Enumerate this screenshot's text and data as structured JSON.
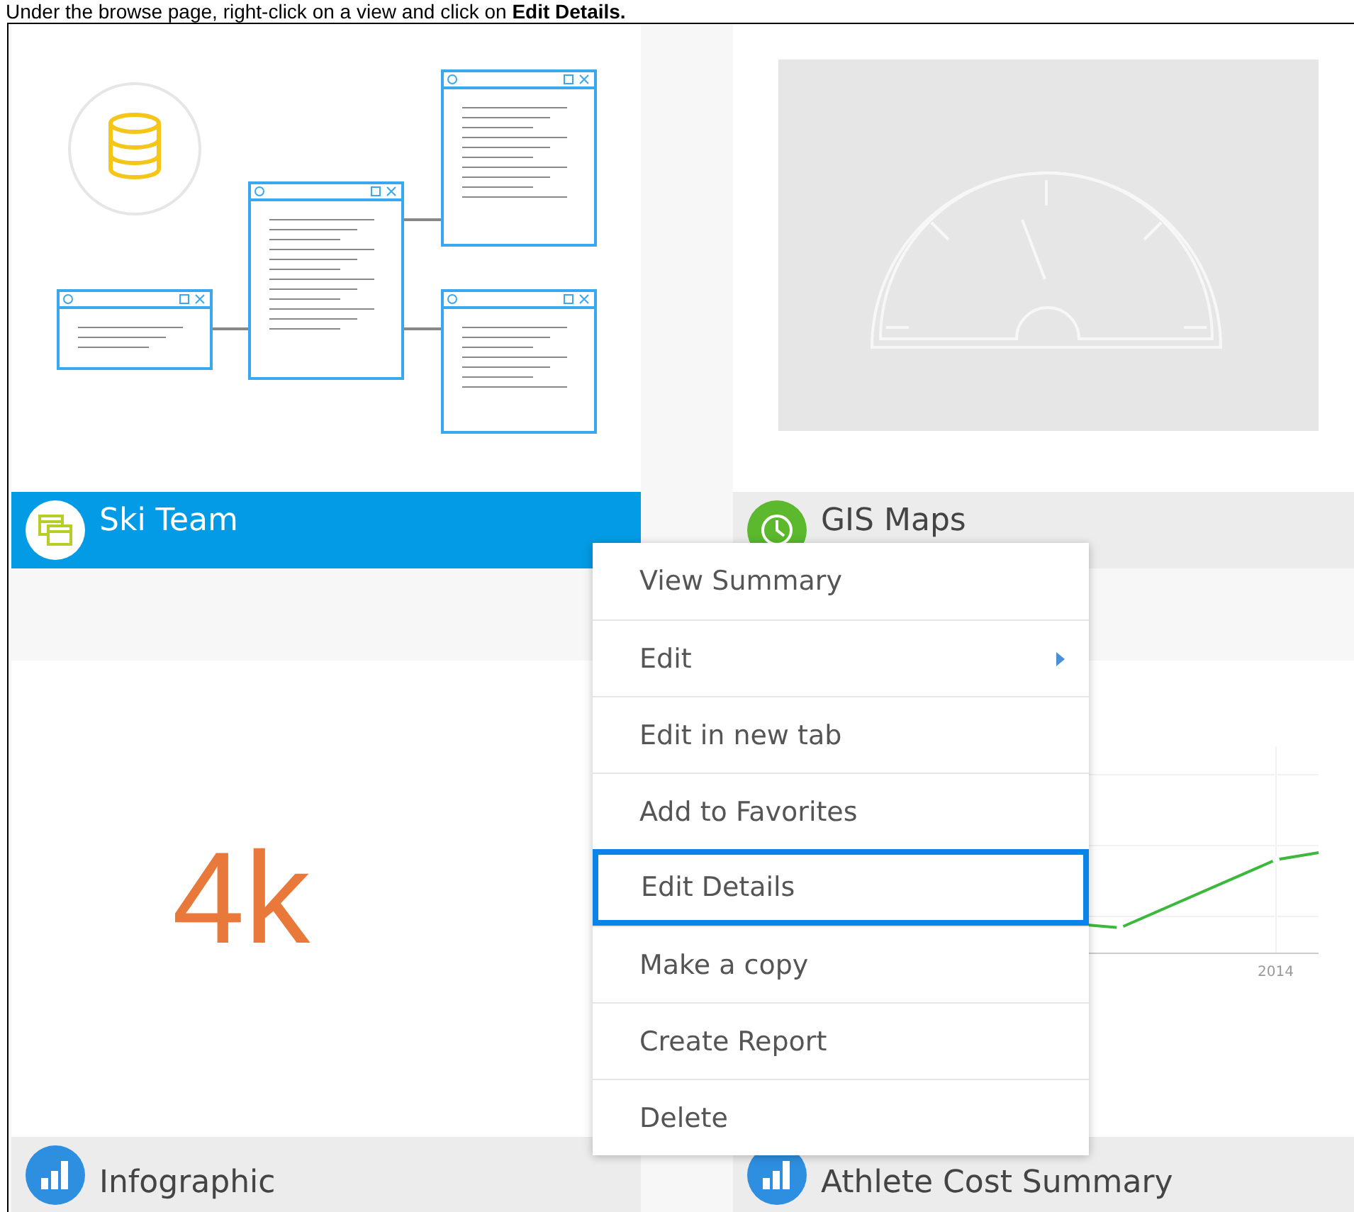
{
  "caption": "Under the browse page, right-click on a view and click on **Edit Details.**",
  "views": [
    {
      "title": "Ski Team",
      "kind": "diagram",
      "selected": true
    },
    {
      "title": "GIS Maps",
      "kind": "gauge",
      "selected": false
    },
    {
      "title": "Infographic",
      "kind": "metric",
      "value": "4k",
      "selected": false
    },
    {
      "title": "Athlete Cost Summary",
      "kind": "line",
      "axis_label": "2014",
      "selected": false
    }
  ],
  "context_menu": {
    "items": [
      {
        "label": "View Summary",
        "submenu": false,
        "selected": false
      },
      {
        "label": "Edit",
        "submenu": true,
        "selected": false
      },
      {
        "label": "Edit in new tab",
        "submenu": false,
        "selected": false
      },
      {
        "label": "Add to Favorites",
        "submenu": false,
        "selected": false
      },
      {
        "label": "Edit Details",
        "submenu": false,
        "selected": true
      },
      {
        "label": "Make a copy",
        "submenu": false,
        "selected": false
      },
      {
        "label": "Create Report",
        "submenu": false,
        "selected": false
      },
      {
        "label": "Delete",
        "submenu": false,
        "selected": false
      }
    ]
  }
}
